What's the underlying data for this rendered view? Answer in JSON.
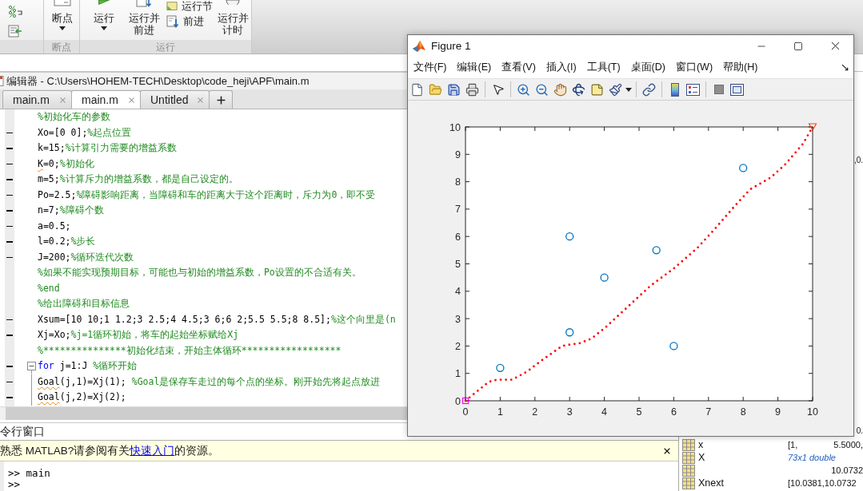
{
  "ribbon": {
    "groups": [
      {
        "label": "断点",
        "buttons": [
          {
            "kind": "dropdown",
            "label": "断点"
          }
        ]
      },
      {
        "label": "运行",
        "buttons": [
          {
            "kind": "dropdown",
            "label": "运行"
          },
          {
            "kind": "large",
            "label": "运行并前进"
          },
          {
            "kind": "stack",
            "items": [
              {
                "label": "运行节"
              },
              {
                "label": "前进"
              }
            ]
          },
          {
            "kind": "large",
            "label": "运行并计时"
          }
        ]
      }
    ]
  },
  "editor": {
    "title": "编辑器 - C:\\Users\\HOHEM-TECH\\Desktop\\code_heji\\APF\\main.m",
    "tabs": [
      {
        "label": "main.m",
        "selected": false
      },
      {
        "label": "main.m",
        "selected": true
      },
      {
        "label": "Untitled",
        "selected": false
      }
    ],
    "lines": [
      {
        "kind": "plain",
        "executable": false,
        "spans": [
          {
            "kind": "comment",
            "text": "%初始化车的参数"
          }
        ]
      },
      {
        "kind": "plain",
        "executable": true,
        "spans": [
          {
            "kind": "code",
            "text": "Xo=[0 0];"
          },
          {
            "kind": "comment",
            "text": "%起点位置"
          }
        ]
      },
      {
        "kind": "plain",
        "executable": true,
        "spans": [
          {
            "kind": "code",
            "text": "k=15;"
          },
          {
            "kind": "comment",
            "text": "%计算引力需要的增益系数"
          }
        ]
      },
      {
        "kind": "plain",
        "executable": true,
        "spans": [
          {
            "kind": "warning",
            "text": "K"
          },
          {
            "kind": "code",
            "text": "=0;"
          },
          {
            "kind": "comment",
            "text": "%初始化"
          }
        ]
      },
      {
        "kind": "plain",
        "executable": true,
        "spans": [
          {
            "kind": "code",
            "text": "m=5;"
          },
          {
            "kind": "comment",
            "text": "%计算斥力的增益系数，都是自己设定的。"
          }
        ]
      },
      {
        "kind": "plain",
        "executable": true,
        "spans": [
          {
            "kind": "code",
            "text": "Po=2.5;"
          },
          {
            "kind": "comment",
            "text": "%障碍影响距离，当障碍和车的距离大于这个距离时，斥力为0，即不受"
          }
        ]
      },
      {
        "kind": "plain",
        "executable": true,
        "spans": [
          {
            "kind": "code",
            "text": "n=7;"
          },
          {
            "kind": "comment",
            "text": "%障碍个数"
          }
        ]
      },
      {
        "kind": "plain",
        "executable": true,
        "spans": [
          {
            "kind": "code",
            "text": "a=0.5;"
          }
        ]
      },
      {
        "kind": "plain",
        "executable": true,
        "spans": [
          {
            "kind": "code",
            "text": "l=0.2;"
          },
          {
            "kind": "comment",
            "text": "%步长"
          }
        ]
      },
      {
        "kind": "plain",
        "executable": true,
        "spans": [
          {
            "kind": "code",
            "text": "J=200;"
          },
          {
            "kind": "comment",
            "text": "%循环迭代次数"
          }
        ]
      },
      {
        "kind": "plain",
        "executable": false,
        "spans": [
          {
            "kind": "comment",
            "text": "%如果不能实现预期目标，可能也与初始的增益系数，Po设置的不合适有关。"
          }
        ]
      },
      {
        "kind": "plain",
        "executable": false,
        "spans": [
          {
            "kind": "comment",
            "text": "%end"
          }
        ]
      },
      {
        "kind": "plain",
        "executable": false,
        "spans": [
          {
            "kind": "comment",
            "text": "%给出障碍和目标信息"
          }
        ]
      },
      {
        "kind": "plain",
        "executable": true,
        "spans": [
          {
            "kind": "code",
            "text": "Xsum=[10 10;1 1.2;3 2.5;4 4.5;3 6;6 2;5.5 5.5;8 8.5];"
          },
          {
            "kind": "comment",
            "text": "%这个向里是(n"
          }
        ]
      },
      {
        "kind": "plain",
        "executable": true,
        "spans": [
          {
            "kind": "code",
            "text": "Xj=Xo;"
          },
          {
            "kind": "comment",
            "text": "%j=1循环初始，将车的起始坐标赋给Xj"
          }
        ]
      },
      {
        "kind": "plain",
        "executable": false,
        "spans": [
          {
            "kind": "comment",
            "text": "%***************初始化结束，开始主体循环******************"
          }
        ]
      },
      {
        "kind": "fold_start",
        "executable": true,
        "spans": [
          {
            "kind": "keyword",
            "text": "for"
          },
          {
            "kind": "code",
            "text": " j=1:J "
          },
          {
            "kind": "comment",
            "text": "%循环开始"
          }
        ]
      },
      {
        "kind": "fold_body",
        "executable": true,
        "spans": [
          {
            "kind": "warning",
            "text": "Goal"
          },
          {
            "kind": "code",
            "text": "(j,1)=Xj(1); "
          },
          {
            "kind": "comment",
            "text": "%Goal是保存车走过的每个点的坐标。刚开始先将起点放进"
          }
        ]
      },
      {
        "kind": "fold_body",
        "executable": true,
        "spans": [
          {
            "kind": "warning",
            "text": "Goal"
          },
          {
            "kind": "code",
            "text": "(j,2)=Xj(2);"
          }
        ]
      }
    ]
  },
  "command_window": {
    "title": "令行窗口",
    "notice": {
      "text_before": "熟悉 MATLAB?请参阅有关",
      "link": "快速入门",
      "text_after": "的资源。"
    },
    "lines": [
      {
        "prompt": ">>",
        "command": "main"
      },
      {
        "prompt": ">>"
      }
    ]
  },
  "workspace": {
    "value_fragments": [
      ",0.",
      "0."
    ],
    "rows": [
      {
        "kind": "value",
        "name": "x",
        "value": "[1,",
        "value_end": "5.5000,"
      },
      {
        "kind": "summary",
        "name": "X",
        "value": "73x1 double"
      },
      {
        "kind": "value",
        "value_end": "10.0732"
      },
      {
        "kind": "value",
        "name": "Xnext",
        "value": "[10.0381,10.0732"
      }
    ]
  },
  "figure": {
    "title": "Figure 1",
    "menu": [
      "文件(F)",
      "编辑(E)",
      "查看(V)",
      "插入(I)",
      "工具(T)",
      "桌面(D)",
      "窗口(W)",
      "帮助(H)"
    ],
    "chart_data": {
      "type": "scatter",
      "xlim": [
        0,
        10
      ],
      "ylim": [
        0,
        10
      ],
      "xticks": [
        0,
        1,
        2,
        3,
        4,
        5,
        6,
        7,
        8,
        9,
        10
      ],
      "yticks": [
        0,
        1,
        2,
        3,
        4,
        5,
        6,
        7,
        8,
        9,
        10
      ],
      "series": [
        {
          "type": "scatter",
          "marker": "circle",
          "color": "#0072bd",
          "x": [
            1,
            3,
            4,
            3,
            6,
            5.5,
            8
          ],
          "values": [
            1.2,
            2.5,
            4.5,
            6,
            2,
            5.5,
            8.5
          ]
        },
        {
          "type": "line",
          "line_style": "dotted",
          "color": "#ff0000",
          "x": [
            0,
            0.33,
            0.67,
            0.9,
            1.34,
            1.77,
            2.19,
            2.78,
            3.0,
            3.29,
            3.63,
            4.05,
            4.64,
            5.32,
            6.0,
            6.68,
            7.18,
            7.77,
            8.2,
            8.79,
            9.21,
            9.72,
            10
          ],
          "values": [
            0,
            0.34,
            0.69,
            0.77,
            0.77,
            1.06,
            1.47,
            2.0,
            2.05,
            2.1,
            2.27,
            2.7,
            3.39,
            4.19,
            4.83,
            5.58,
            6.27,
            7.13,
            7.72,
            8.15,
            8.63,
            9.38,
            10
          ]
        },
        {
          "type": "scatter",
          "marker": "square",
          "color": "#ff00ff",
          "x": [
            0
          ],
          "values": [
            0
          ]
        },
        {
          "type": "scatter",
          "marker": "triangle",
          "color": "#f04a1e",
          "x": [
            10
          ],
          "values": [
            10
          ]
        }
      ]
    }
  }
}
